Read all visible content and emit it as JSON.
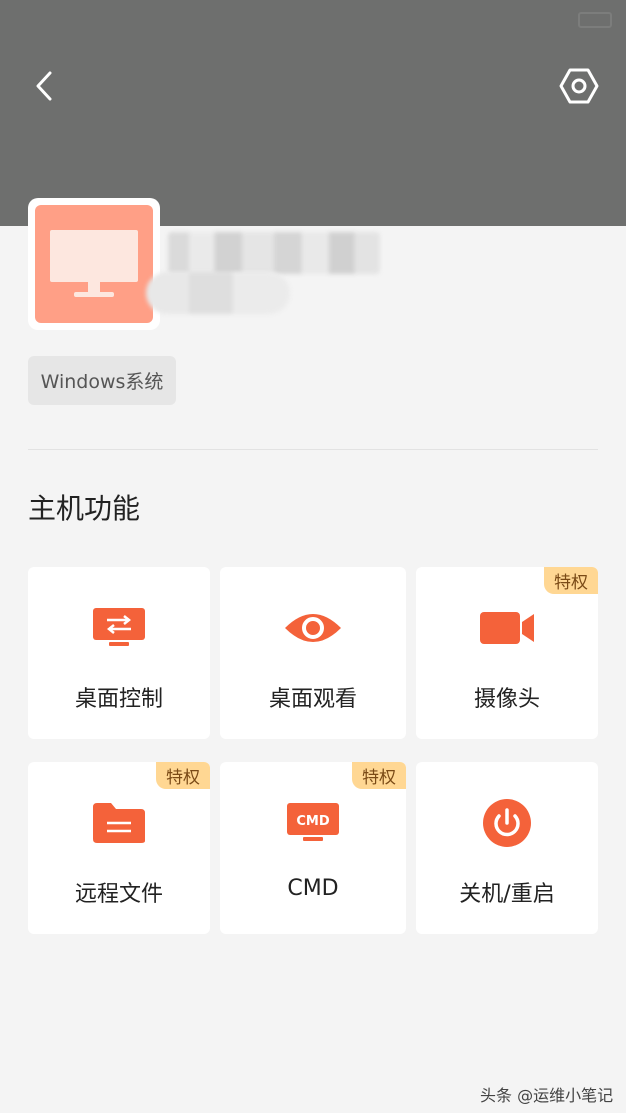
{
  "header": {
    "back_icon": "chevron-left-icon",
    "settings_icon": "hexagon-settings-icon",
    "background_color": "#6e6f6e"
  },
  "device": {
    "icon": "monitor-icon",
    "avatar_color": "#ff9f86",
    "os_tag": "Windows系统"
  },
  "section": {
    "title": "主机功能"
  },
  "functions": [
    {
      "label": "桌面控制",
      "icon": "desktop-control-icon",
      "badge": ""
    },
    {
      "label": "桌面观看",
      "icon": "eye-icon",
      "badge": ""
    },
    {
      "label": "摄像头",
      "icon": "camera-icon",
      "badge": "特权"
    },
    {
      "label": "远程文件",
      "icon": "folder-icon",
      "badge": "特权"
    },
    {
      "label": "CMD",
      "icon": "cmd-icon",
      "badge": "特权"
    },
    {
      "label": "关机/重启",
      "icon": "power-icon",
      "badge": ""
    }
  ],
  "colors": {
    "accent": "#f4623a",
    "badge_bg": "#ffd793",
    "badge_text": "#7a4a16",
    "page_bg": "#f4f4f4"
  },
  "watermark": "头条 @运维小笔记"
}
